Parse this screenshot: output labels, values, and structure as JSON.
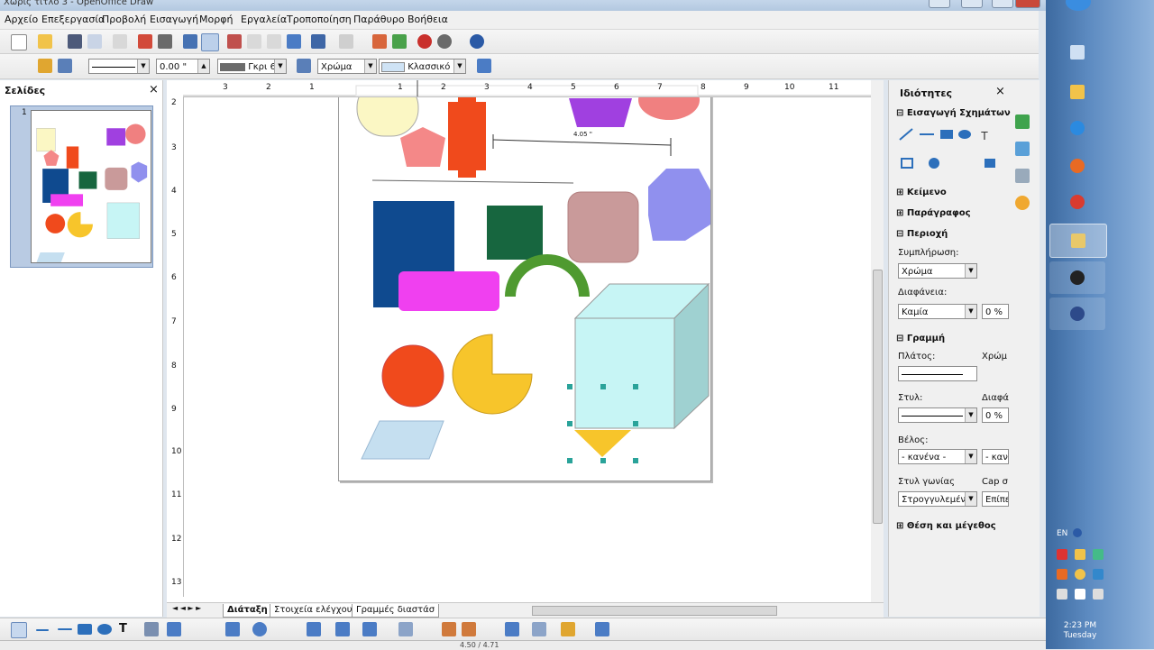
{
  "window": {
    "title": "Χωρίς τίτλο 3 - OpenOffice Draw"
  },
  "menu": [
    "Αρχείο",
    "Επεξεργασία",
    "Προβολή",
    "Εισαγωγή",
    "Μορφή",
    "Εργαλεία",
    "Τροποποίηση",
    "Παράθυρο",
    "Βοήθεια"
  ],
  "line_toolbar": {
    "line_width": "0.00 \"",
    "area_color": "Γκρι 6",
    "area_style": "Χρώμα",
    "area_fill": "Κλασσικό μ"
  },
  "slides_panel": {
    "title": "Σελίδες",
    "page_number": "1"
  },
  "ruler": {
    "h_ticks": [
      "3",
      "2",
      "1",
      "1",
      "2",
      "3",
      "4",
      "5",
      "6",
      "7",
      "8",
      "9",
      "10",
      "11"
    ],
    "v_ticks": [
      "2",
      "3",
      "4",
      "5",
      "6",
      "7",
      "8",
      "9",
      "10",
      "11",
      "12",
      "13"
    ]
  },
  "canvas": {
    "dimension_label": "4.05 \""
  },
  "tabs": [
    "Διάταξη",
    "Στοιχεία ελέγχου",
    "Γραμμές διαστάσ"
  ],
  "properties": {
    "title": "Ιδιότητες",
    "sections": {
      "insert_shapes": "Εισαγωγή Σχημάτων",
      "text": "Κείμενο",
      "paragraph": "Παράγραφος",
      "area": "Περιοχή",
      "line": "Γραμμή",
      "position_size": "Θέση και μέγεθος"
    },
    "labels": {
      "fill": "Συμπλήρωση:",
      "transparency": "Διαφάνεια:",
      "width": "Πλάτος:",
      "color": "Χρώμ",
      "style": "Στυλ:",
      "transparency2": "Διαφά",
      "arrow": "Βέλος:",
      "corner_style": "Στυλ γωνίας",
      "cap_style": "Cap σ"
    },
    "values": {
      "fill": "Χρώμα",
      "transparency": "Καμία",
      "transparency_pct": "0 %",
      "line_transparency_pct": "0 %",
      "arrow_start": "- κανένα -",
      "arrow_end": "- κανέ",
      "corner_style": "Στρογγυλεμένο",
      "cap_style": "Επίπε"
    }
  },
  "status": {
    "text": "4.50 / 4.71"
  },
  "taskbar": {
    "lang": "EN",
    "time": "2:23 PM",
    "day": "Tuesday"
  },
  "colors": {
    "accent": "#2c6fbb",
    "shape_blue": "#0f4a8f",
    "shape_green": "#17663f",
    "cube": "#c7f5f5"
  }
}
